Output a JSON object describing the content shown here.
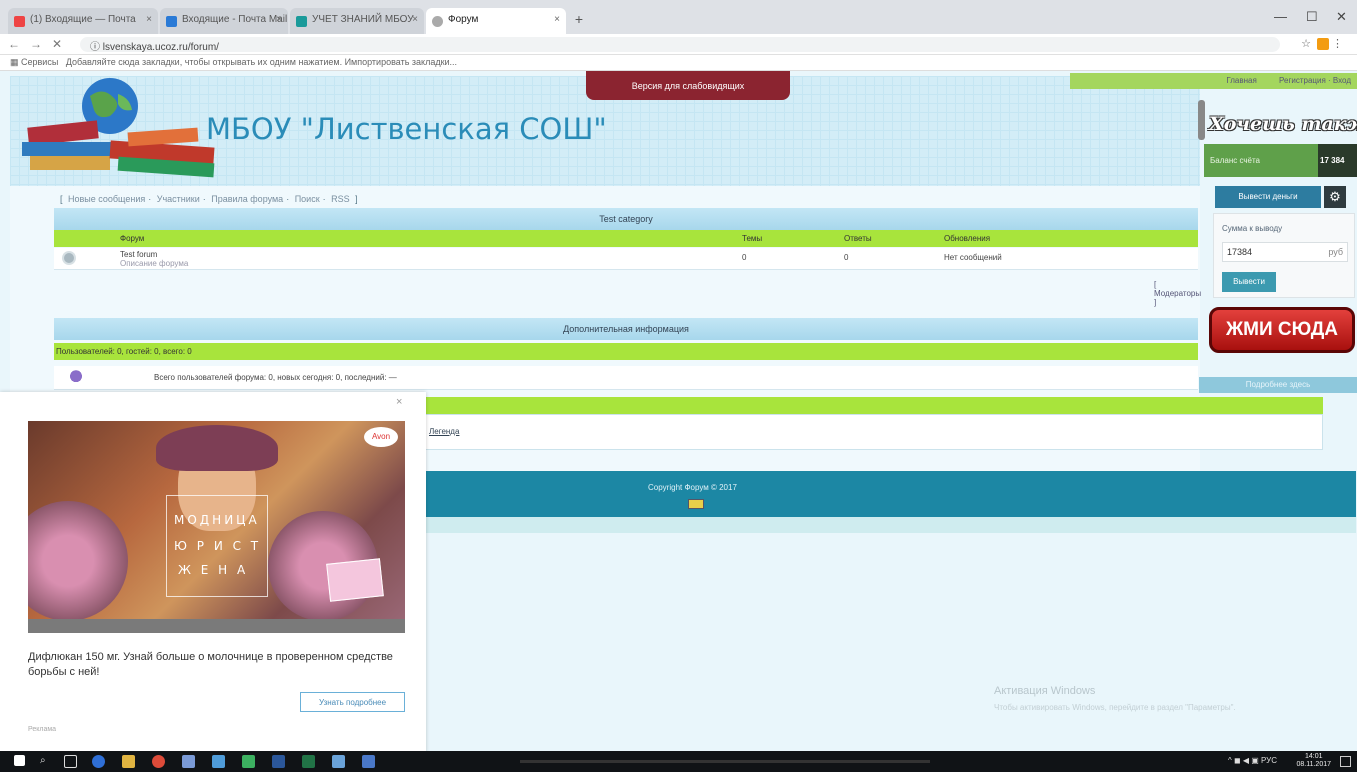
{
  "browser": {
    "tabs": [
      {
        "label": "(1) Входящие — Почта",
        "color": "#e44"
      },
      {
        "label": "Входящие - Почта Mail.Ru",
        "color": "#2a7ad6"
      },
      {
        "label": "УЧЕТ ЗНАНИЙ МБОУ",
        "color": "#1a9a9a"
      },
      {
        "label": "Форум",
        "color": "#aaa"
      }
    ],
    "new_tab": "+",
    "window_controls": [
      "—",
      "☐",
      "✕"
    ],
    "url": "lsvenskaya.ucoz.ru/forum/",
    "bookmarks_label": "Сервисы",
    "bookmarks_text": "Добавляйте сюда закладки, чтобы открывать их одним нажатием. Импортировать закладки..."
  },
  "header": {
    "site_title": "МБОУ \"Лиственская СОШ\"",
    "top_button": "Версия для слабовидящих",
    "top_right_left": "Главная",
    "top_right_right": "Регистрация · Вход"
  },
  "breadcrumbs": [
    "Новые сообщения",
    "Участники",
    "Правила форума",
    "Поиск",
    "RSS"
  ],
  "forum": {
    "section_title": "Test category",
    "columns": [
      "Форум",
      "Темы",
      "Ответы",
      "Обновления"
    ],
    "rows": [
      {
        "name": "Test forum",
        "desc": "Описание форума",
        "topics": "0",
        "replies": "0",
        "last": "Нет сообщений"
      }
    ],
    "pager": "[ Модераторы ]"
  },
  "info": {
    "title": "Дополнительная информация",
    "online_line": "Пользователей: 0, гостей: 0, всего: 0",
    "stats_line": "Всего пользователей форума: 0, новых сегодня: 0, последний: —",
    "legend_link": "Легенда"
  },
  "footer": {
    "copyright": "Copyright Форум © 2017"
  },
  "widget": {
    "title": "Хочешь также?",
    "balance_label": "Баланс счёта",
    "balance_value": "17 384",
    "withdraw_button": "Вывести деньги",
    "amount_label": "Сумма к выводу",
    "amount_value": "17384",
    "currency": "руб",
    "submit_button": "Вывести",
    "cta_button": "ЖМИ СЮДА",
    "footer": "Подробнее здесь"
  },
  "popup": {
    "close": "×",
    "ad_words": [
      "МОДНИЦА",
      "Ю Р И С Т",
      "Ж Е Н А"
    ],
    "ad_badge": "Avon",
    "text": "Дифлюкан 150 мг. Узнай больше о молочнице в проверенном средстве борьбы с ней!",
    "button": "Узнать подробнее",
    "footer": "Реклама"
  },
  "watermark": {
    "title": "Активация Windows",
    "subtitle": "Чтобы активировать Windows, перейдите в раздел \"Параметры\"."
  },
  "taskbar": {
    "tray": "^ ◼ ◀ ▣ РУС",
    "time": "14:01",
    "date": "08.11.2017"
  },
  "colors": {
    "accent_blue": "#2a8cb8",
    "green_bar": "#a8e43c",
    "footer_teal": "#1c87a4",
    "cta_red": "#c8201c"
  }
}
